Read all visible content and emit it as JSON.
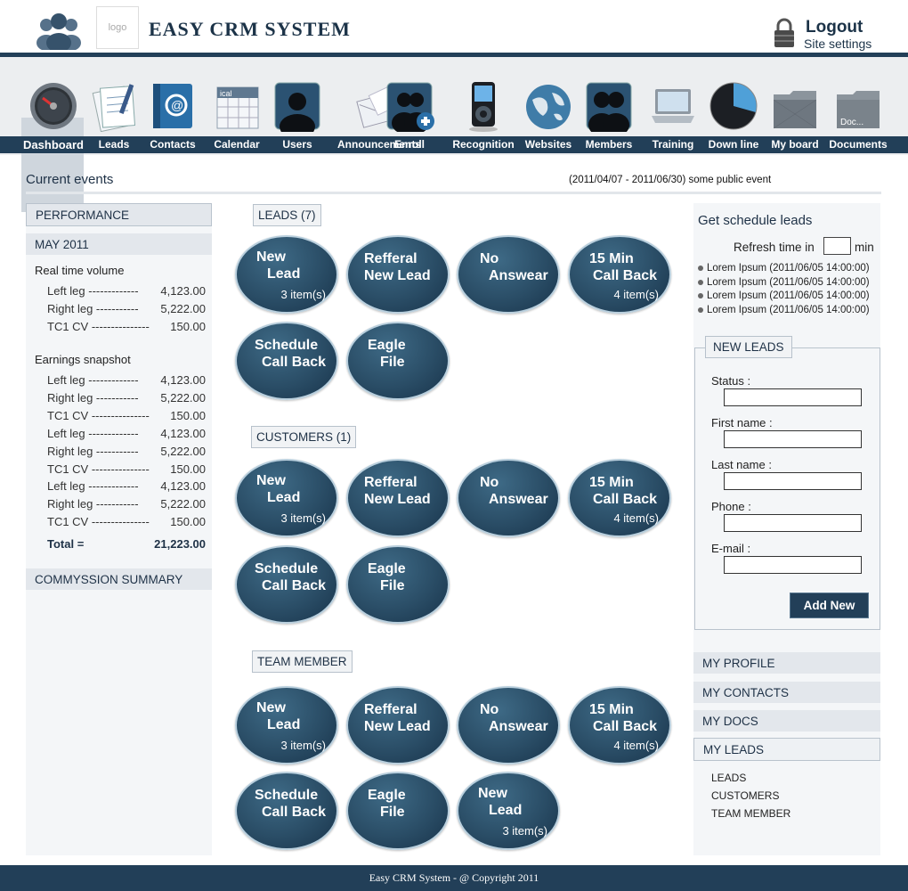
{
  "header": {
    "logo_text": "logo",
    "title": "EASY  CRM  SYSTEM",
    "logout": "Logout",
    "settings": "Site settings"
  },
  "nav": [
    {
      "label": "Dashboard",
      "icon": "gauge-icon"
    },
    {
      "label": "Leads",
      "icon": "notepad-icon"
    },
    {
      "label": "Contacts",
      "icon": "address-book-icon"
    },
    {
      "label": "Calendar",
      "icon": "calendar-icon"
    },
    {
      "label": "Users",
      "icon": "user-icon"
    },
    {
      "label": "Announcements",
      "icon": "envelope-icon"
    },
    {
      "label": "Enroll",
      "icon": "add-user-icon"
    },
    {
      "label": "Recognition",
      "icon": "media-player-icon"
    },
    {
      "label": "Websites",
      "icon": "globe-icon"
    },
    {
      "label": "Members",
      "icon": "group-icon"
    },
    {
      "label": "Training",
      "icon": "laptop-icon"
    },
    {
      "label": "Down line",
      "icon": "pie-chart-icon"
    },
    {
      "label": "My board",
      "icon": "folder-icon"
    },
    {
      "label": "Documents",
      "icon": "document-folder-icon",
      "icon_text": "Doc..."
    }
  ],
  "current_events": {
    "title": "Current events",
    "event": "(2011/04/07 - 2011/06/30) some public event"
  },
  "left": {
    "performance": "PERFORMANCE",
    "month": "MAY 2011",
    "rt_title": "Real time volume",
    "rt_rows": [
      {
        "label": "Left leg  -------------",
        "value": "4,123.00"
      },
      {
        "label": "Right leg  -----------",
        "value": "5,222.00"
      },
      {
        "label": "TC1 CV  ---------------",
        "value": "150.00"
      }
    ],
    "es_title": "Earnings snapshot",
    "es_rows": [
      {
        "label": "Left leg  -------------",
        "value": "4,123.00"
      },
      {
        "label": "Right leg  -----------",
        "value": "5,222.00"
      },
      {
        "label": "TC1 CV  ---------------",
        "value": "150.00"
      },
      {
        "label": "Left leg  -------------",
        "value": "4,123.00"
      },
      {
        "label": "Right leg  -----------",
        "value": "5,222.00"
      },
      {
        "label": "TC1 CV  ---------------",
        "value": "150.00"
      },
      {
        "label": "Left leg  -------------",
        "value": "4,123.00"
      },
      {
        "label": "Right leg  -----------",
        "value": "5,222.00"
      },
      {
        "label": "TC1 CV  ---------------",
        "value": "150.00"
      }
    ],
    "total_label": "Total =",
    "total_value": "21,223.00",
    "commission": "COMMYSSION SUMMARY"
  },
  "sections": [
    {
      "tag": "LEADS (7)",
      "items": [
        {
          "l1": "New",
          "l2": "Lead",
          "count": "3 item(s)"
        },
        {
          "l1": "Refferal",
          "l2": "New Lead"
        },
        {
          "l1": "No",
          "l2": "Answear"
        },
        {
          "l1": "15 Min",
          "l2": "Call Back",
          "count": "4 item(s)"
        },
        {
          "l1": "Schedule",
          "l2": "Call Back"
        },
        {
          "l1": "Eagle",
          "l2": "File"
        }
      ]
    },
    {
      "tag": "CUSTOMERS (1)",
      "items": [
        {
          "l1": "New",
          "l2": "Lead",
          "count": "3 item(s)"
        },
        {
          "l1": "Refferal",
          "l2": "New Lead"
        },
        {
          "l1": "No",
          "l2": "Answear"
        },
        {
          "l1": "15 Min",
          "l2": "Call Back",
          "count": "4 item(s)"
        },
        {
          "l1": "Schedule",
          "l2": "Call Back"
        },
        {
          "l1": "Eagle",
          "l2": "File"
        }
      ]
    },
    {
      "tag": "TEAM MEMBER",
      "items": [
        {
          "l1": "New",
          "l2": "Lead",
          "count": "3 item(s)"
        },
        {
          "l1": "Refferal",
          "l2": "New Lead"
        },
        {
          "l1": "No",
          "l2": "Answear"
        },
        {
          "l1": "15 Min",
          "l2": "Call Back",
          "count": "4 item(s)"
        },
        {
          "l1": "Schedule",
          "l2": "Call Back"
        },
        {
          "l1": "Eagle",
          "l2": "File"
        },
        {
          "l1": "New",
          "l2": "Lead",
          "count": "3 item(s)"
        }
      ]
    }
  ],
  "right": {
    "schedule_title": "Get schedule leads",
    "refresh_label": "Refresh time in",
    "refresh_value": "",
    "min_label": "min",
    "events": [
      "Lorem Ipsum (2011/06/05 14:00:00)",
      "Lorem Ipsum (2011/06/05 14:00:00)",
      "Lorem Ipsum (2011/06/05 14:00:00)",
      "Lorem Ipsum (2011/06/05 14:00:00)"
    ],
    "new_leads": "NEW LEADS",
    "fields": [
      {
        "label": "Status :",
        "value": ""
      },
      {
        "label": "First name :",
        "value": ""
      },
      {
        "label": "Last name :",
        "value": ""
      },
      {
        "label": "Phone :",
        "value": ""
      },
      {
        "label": "E-mail :",
        "value": ""
      }
    ],
    "add_button": "Add New",
    "menu": [
      "MY PROFILE",
      "MY CONTACTS",
      "MY DOCS",
      "MY LEADS"
    ],
    "submenu": [
      "LEADS",
      "CUSTOMERS",
      "TEAM MEMBER"
    ]
  },
  "footer": "Easy CRM System - @ Copyright 2011",
  "colors": {
    "primary": "#223f58",
    "oval": "#2a4d66",
    "panel": "#f4f6f8"
  }
}
